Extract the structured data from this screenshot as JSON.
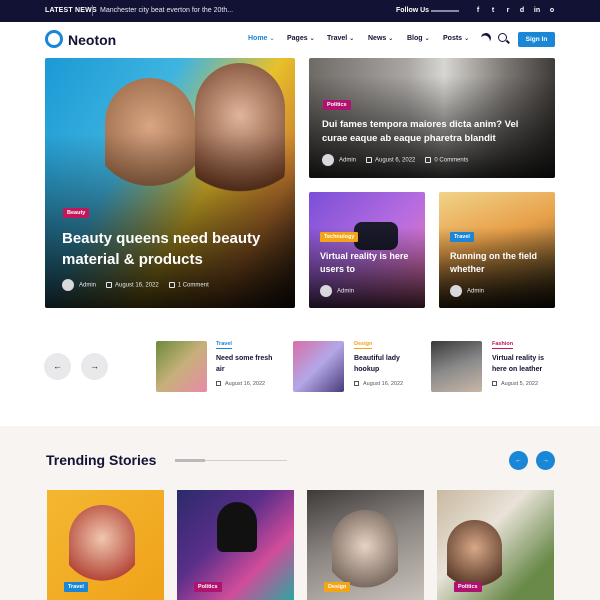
{
  "topbar": {
    "latest_label": "LATEST NEWS",
    "ticker": "Manchester city beat everton for the 20th...",
    "follow_label": "Follow Us",
    "social": [
      {
        "icon": "facebook-icon",
        "glyph": "f"
      },
      {
        "icon": "twitter-icon",
        "glyph": "t"
      },
      {
        "icon": "rss-icon",
        "glyph": "r"
      },
      {
        "icon": "dribbble-icon",
        "glyph": "d"
      },
      {
        "icon": "linkedin-icon",
        "glyph": "in"
      },
      {
        "icon": "instagram-icon",
        "glyph": "o"
      }
    ]
  },
  "nav": {
    "logo": "Neoton",
    "menu": [
      "Home",
      "Pages",
      "Travel",
      "News",
      "Blog",
      "Posts"
    ],
    "active": "Home",
    "signin": "Sign In"
  },
  "hero": {
    "main": {
      "category": "Beauty",
      "title": "Beauty queens need beauty material & products",
      "author": "Admin",
      "date": "August 16, 2022",
      "comments": "1 Comment"
    },
    "top_right": {
      "category": "Politics",
      "title": "Dui fames tempora maiores dicta anim? Vel curae eaque ab eaque pharetra blandit",
      "author": "Admin",
      "date": "August 6, 2022",
      "comments": "0 Comments"
    },
    "small": [
      {
        "category": "Technology",
        "title": "Virtual reality is here users to",
        "author": "Admin"
      },
      {
        "category": "Travel",
        "title": "Running on the field whether",
        "author": "Admin"
      }
    ]
  },
  "slider": {
    "prev": "←",
    "next": "→",
    "items": [
      {
        "category": "Travel",
        "title": "Need some fresh air",
        "date": "August 16, 2022"
      },
      {
        "category": "Design",
        "title": "Beautiful lady hookup",
        "date": "August 16, 2022"
      },
      {
        "category": "Fashion",
        "title": "Virtual reality is here on leather",
        "date": "August 5, 2022"
      }
    ]
  },
  "trending": {
    "title": "Trending Stories",
    "prev": "←",
    "next": "→",
    "cards": [
      {
        "category": "Travel"
      },
      {
        "category": "Politics"
      },
      {
        "category": "Design"
      },
      {
        "category": "Politics"
      }
    ]
  },
  "colors": {
    "accent": "#1a86d6",
    "dark": "#121234",
    "politics": "#b0136f",
    "design": "#f2a516",
    "fashion": "#c2185b"
  }
}
